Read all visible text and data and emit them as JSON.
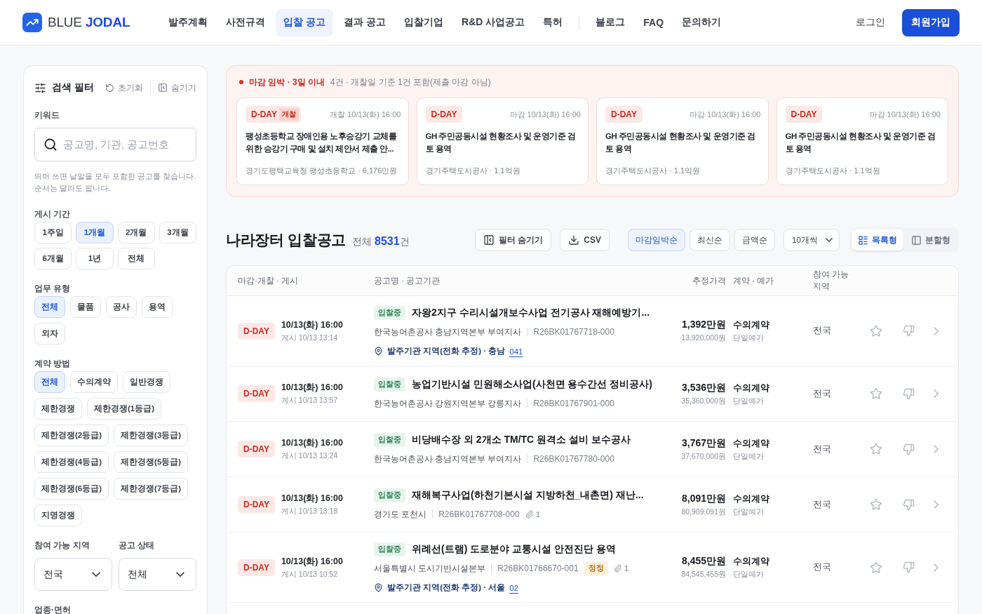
{
  "header": {
    "brand": "BLUE **JODAL**",
    "nav": [
      {
        "label": "발주계획",
        "selected": false
      },
      {
        "label": "사전규격",
        "selected": false
      },
      {
        "label": "입찰 공고",
        "selected": true
      },
      {
        "label": "결과 공고",
        "selected": false
      },
      {
        "label": "입찰기업",
        "selected": false
      },
      {
        "label": "R&D 사업공고",
        "selected": false
      },
      {
        "label": "특허",
        "selected": false
      }
    ],
    "nav_more": [
      {
        "label": "블로그",
        "selected": false
      },
      {
        "label": "FAQ",
        "selected": false
      },
      {
        "label": "문의하기",
        "selected": false
      }
    ],
    "login": "로그인",
    "signup": "회원가입"
  },
  "filter_panel": {
    "title": "검색 필터",
    "reset": "초기화",
    "hide": "숨기기",
    "keyword": {
      "label": "키워드",
      "placeholder": "공고명, 기관, 공고번호",
      "hint": "띄어 쓰면 낱말을 모두 포함한 공고를 찾습니다. 순서는 달라도 됩니다."
    },
    "groups": [
      {
        "label": "게시 기간",
        "kind": "grid",
        "options": [
          {
            "label": "1주일",
            "selected": false
          },
          {
            "label": "1개월",
            "selected": true
          },
          {
            "label": "2개월",
            "selected": false
          },
          {
            "label": "3개월",
            "selected": false
          },
          {
            "label": "6개월",
            "selected": false
          },
          {
            "label": "1년",
            "selected": false
          },
          {
            "label": "전체",
            "selected": false
          }
        ]
      },
      {
        "label": "업무 유형",
        "kind": "wrap",
        "options": [
          {
            "label": "전체",
            "selected": true
          },
          {
            "label": "물품",
            "selected": false
          },
          {
            "label": "공사",
            "selected": false
          },
          {
            "label": "용역",
            "selected": false
          },
          {
            "label": "외자",
            "selected": false
          }
        ]
      },
      {
        "label": "계약 방법",
        "kind": "wrap",
        "options": [
          {
            "label": "전체",
            "selected": true
          },
          {
            "label": "수의계약",
            "selected": false
          },
          {
            "label": "일반경쟁",
            "selected": false
          },
          {
            "label": "제한경쟁",
            "selected": false
          },
          {
            "label": "제한경쟁(1등급)",
            "selected": false
          },
          {
            "label": "제한경쟁(2등급)",
            "selected": false
          },
          {
            "label": "제한경쟁(3등급)",
            "selected": false
          },
          {
            "label": "제한경쟁(4등급)",
            "selected": false
          },
          {
            "label": "제한경쟁(5등급)",
            "selected": false
          },
          {
            "label": "제한경쟁(6등급)",
            "selected": false
          },
          {
            "label": "제한경쟁(7등급)",
            "selected": false
          },
          {
            "label": "지명경쟁",
            "selected": false
          }
        ]
      }
    ],
    "selects": [
      {
        "label": "참여 가능 지역",
        "value": "전국"
      },
      {
        "label": "공고 상태",
        "value": "전체"
      }
    ],
    "next_section": "업종·면허"
  },
  "deadline_alert": {
    "title": "마감 임박 · 3일 이내",
    "summary": "4건 · 개찰일 기준 1건 포함(제출 마감 아님)",
    "cards": [
      {
        "badge": "D-DAY",
        "tag": "개찰",
        "when": "개찰 10/13(화) 16:00",
        "title": "팽성초등학교 장애인용 노후승강기 교체를 위한 승강기 구매 및 설치 제안서 제출 안...",
        "meta": "경기도평택교육청 팽성초등학교 · 6,176만원"
      },
      {
        "badge": "D-DAY",
        "when": "마감 10/13(화) 16:00",
        "title": "GH 주민공동시설 현황조사 및 운영기준 검토 용역",
        "meta": "경기주택도시공사 · 1.1억원"
      },
      {
        "badge": "D-DAY",
        "when": "마감 10/13(화) 16:00",
        "title": "GH 주민공동시설 현황조사 및 운영기준 검토 용역",
        "meta": "경기주택도시공사 · 1.1억원"
      },
      {
        "badge": "D-DAY",
        "when": "마감 10/13(화) 16:00",
        "title": "GH 주민공동시설 현황조사 및 운영기준 검토 용역",
        "meta": "경기주택도시공사 · 1.1억원"
      }
    ]
  },
  "listing": {
    "title": "나라장터 입찰공고",
    "total": "전체 **8531**건",
    "filter_toggle": "필터 숨기기",
    "export": "CSV",
    "sorts": [
      {
        "label": "마감임박순",
        "selected": true
      },
      {
        "label": "최신순",
        "selected": false
      },
      {
        "label": "금액순",
        "selected": false
      }
    ],
    "page_size": "10개씩",
    "views": [
      {
        "label": "목록형",
        "kind": "list",
        "selected": true
      },
      {
        "label": "분할형",
        "kind": "split",
        "selected": false
      }
    ],
    "columns": [
      "마감·개찰 · 게시",
      "공고명 · 공고기관",
      "추정가격",
      "계약 · 예가",
      "참여 가능 지역"
    ],
    "rows": [
      {
        "dday": "D-DAY",
        "deadline": "10/13(화) 16:00",
        "posted": "게시 10/13 13:14",
        "status": "입찰중",
        "title": "자왕2지구 수리시설개보수사업 전기공사 재해예방기...",
        "agency": "한국농어촌공사 충남지역본부 부여지사",
        "code": "R26BK01767718-000",
        "location": {
          "text": "발주기관 지역(전화 추정) · 충남",
          "code": "041"
        },
        "price": "1,392만원",
        "price_exact": "13,920,000원",
        "contract": "수의계약",
        "price_type": "단일예가",
        "region": "전국",
        "starred": false,
        "disliked": false
      },
      {
        "dday": "D-DAY",
        "deadline": "10/13(화) 16:00",
        "posted": "게시 10/13 13:57",
        "status": "입찰중",
        "title": "농업기반시설 민원해소사업(사천면 용수간선 정비공사)",
        "agency": "한국농어촌공사 강원지역본부 강릉지사",
        "code": "R26BK01767901-000",
        "price": "3,536만원",
        "price_exact": "35,360,000원",
        "contract": "수의계약",
        "price_type": "단일예가",
        "region": "전국",
        "starred": false,
        "disliked": false
      },
      {
        "dday": "D-DAY",
        "deadline": "10/13(화) 16:00",
        "posted": "게시 10/13 13:24",
        "status": "입찰중",
        "title": "비당배수장 외 2개소 TM/TC 원격소 설비 보수공사",
        "agency": "한국농어촌공사 충남지역본부 부여지사",
        "code": "R26BK01767780-000",
        "price": "3,767만원",
        "price_exact": "37,670,000원",
        "contract": "수의계약",
        "price_type": "단일예가",
        "region": "전국",
        "starred": false,
        "disliked": false
      },
      {
        "dday": "D-DAY",
        "deadline": "10/13(화) 16:00",
        "posted": "게시 10/13 13:18",
        "status": "입찰중",
        "title": "재해복구사업(하천기본시설 지방하천_내촌면) 재난...",
        "agency": "경기도 포천시",
        "code": "R26BK01767708-000",
        "attachments": "1",
        "price": "8,091만원",
        "price_exact": "80,909,091원",
        "contract": "수의계약",
        "price_type": "단일예가",
        "region": "전국",
        "starred": false,
        "disliked": false
      },
      {
        "dday": "D-DAY",
        "deadline": "10/13(화) 16:00",
        "posted": "게시 10/13 10:52",
        "status": "입찰중",
        "title": "위례선(트램) 도로분야 교통시설 안전진단 용역",
        "agency": "서울특별시 도시기반시설본부",
        "code": "R26BK01766670-001",
        "correction": "정정",
        "attachments": "1",
        "location": {
          "text": "발주기관 지역(전화 추정) · 서울",
          "code": "02"
        },
        "price": "8,455만원",
        "price_exact": "84,545,455원",
        "contract": "수의계약",
        "price_type": "단일예가",
        "region": "전국",
        "starred": false,
        "disliked": false
      }
    ]
  }
}
